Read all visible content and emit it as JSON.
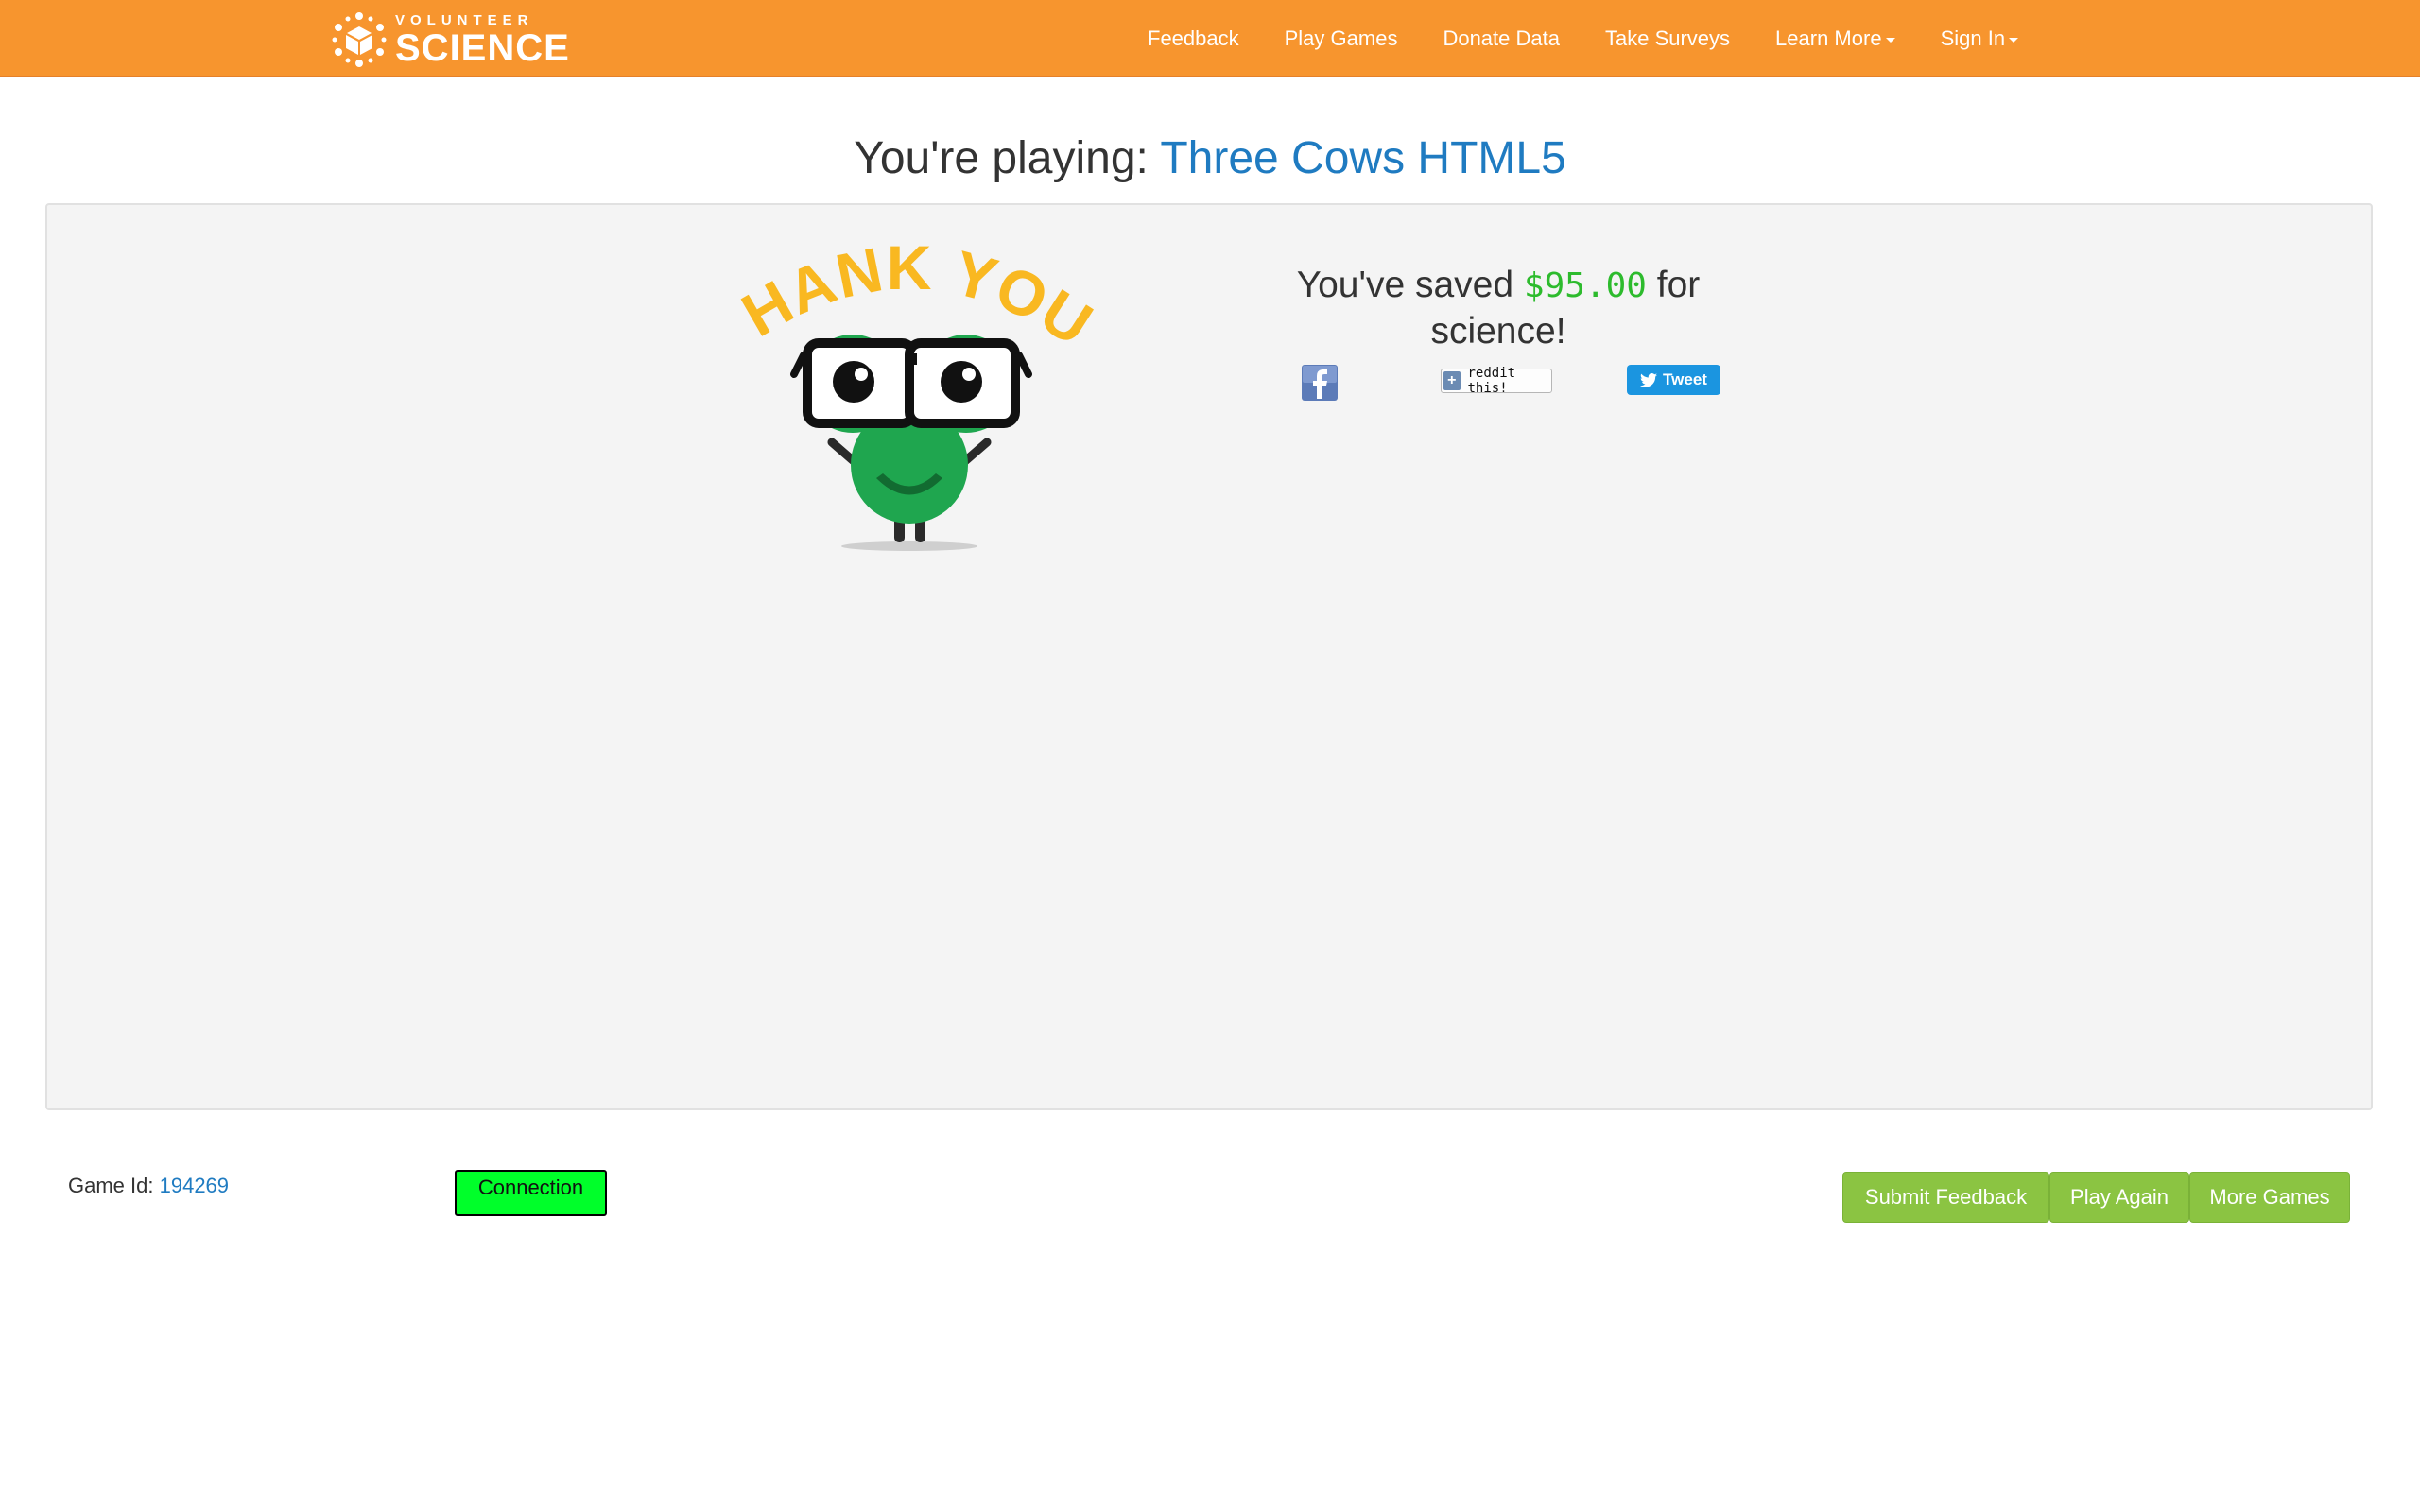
{
  "brand": {
    "small": "VOLUNTEER",
    "big": "SCIENCE",
    "logo_icon": "cube-network-logo"
  },
  "nav": {
    "items": [
      {
        "label": "Feedback",
        "dropdown": false
      },
      {
        "label": "Play Games",
        "dropdown": false
      },
      {
        "label": "Donate Data",
        "dropdown": false
      },
      {
        "label": "Take Surveys",
        "dropdown": false
      },
      {
        "label": "Learn More",
        "dropdown": true
      },
      {
        "label": "Sign In",
        "dropdown": true
      }
    ]
  },
  "title": {
    "prefix": "You're playing:",
    "game_name": "Three Cows HTML5"
  },
  "result": {
    "thank_you": "THANK YOU!",
    "saved_prefix": "You've saved",
    "saved_amount": "$95.00",
    "saved_suffix": "for science!"
  },
  "share": {
    "facebook_icon": "facebook-icon",
    "reddit_label": "reddit this!",
    "tweet_label": "Tweet"
  },
  "footer": {
    "game_id_label": "Game Id:",
    "game_id_value": "194269",
    "connection_label": "Connection",
    "buttons": {
      "submit_feedback": "Submit Feedback",
      "play_again": "Play Again",
      "more_games": "More Games"
    }
  },
  "colors": {
    "navbar": "#f7952e",
    "link": "#1f7bc1",
    "amount": "#2dbb2d",
    "button": "#8bc442",
    "connection": "#00ff2a",
    "mascot": "#1fa64f",
    "thank_you": "#f9b821"
  }
}
